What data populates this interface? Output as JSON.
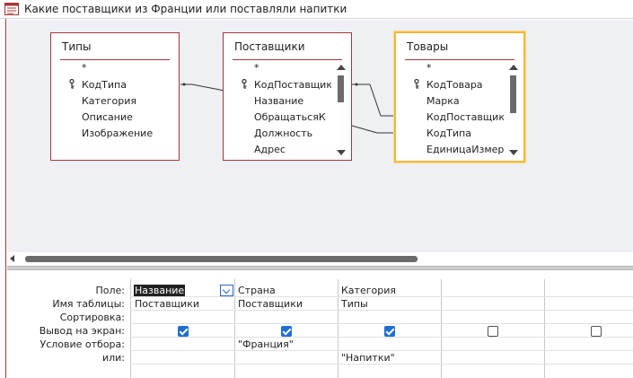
{
  "window": {
    "title": "Какие поставщики из Франции или поставляли напитки"
  },
  "tables": [
    {
      "title": "Типы",
      "fields": [
        "*",
        "КодТипа",
        "Категория",
        "Описание",
        "Изображение"
      ],
      "key_field": "КодТипа"
    },
    {
      "title": "Поставщики",
      "fields": [
        "*",
        "КодПоставщика",
        "Название",
        "ОбращатьсяК",
        "Должность",
        "Адрес"
      ],
      "key_field": "КодПоставщика"
    },
    {
      "title": "Товары",
      "fields": [
        "*",
        "КодТовара",
        "Марка",
        "КодПоставщика",
        "КодТипа",
        "ЕдиницаИзмере"
      ],
      "key_field": "КодТовара",
      "selected": true
    }
  ],
  "grid": {
    "row_labels": [
      "Поле:",
      "Имя таблицы:",
      "Сортировка:",
      "Вывод на экран:",
      "Условие отбора:",
      "или:"
    ],
    "columns": [
      {
        "field": "Название",
        "table": "Поставщики",
        "sort": "",
        "show": true,
        "criteria": "",
        "or": ""
      },
      {
        "field": "Страна",
        "table": "Поставщики",
        "sort": "",
        "show": true,
        "criteria": "\"Франция\"",
        "or": ""
      },
      {
        "field": "Категория",
        "table": "Типы",
        "sort": "",
        "show": true,
        "criteria": "",
        "or": "\"Напитки\""
      },
      {
        "field": "",
        "table": "",
        "sort": "",
        "show": false,
        "criteria": "",
        "or": ""
      },
      {
        "field": "",
        "table": "",
        "sort": "",
        "show": false,
        "criteria": "",
        "or": ""
      }
    ]
  },
  "colors": {
    "table_border": "#a4373a",
    "selected_border": "#f4b73a",
    "checkbox": "#1f6fd1",
    "diagram_bg": "#eef0f3"
  },
  "icons": {
    "title": "query-design-icon",
    "key": "primary-key-icon"
  }
}
